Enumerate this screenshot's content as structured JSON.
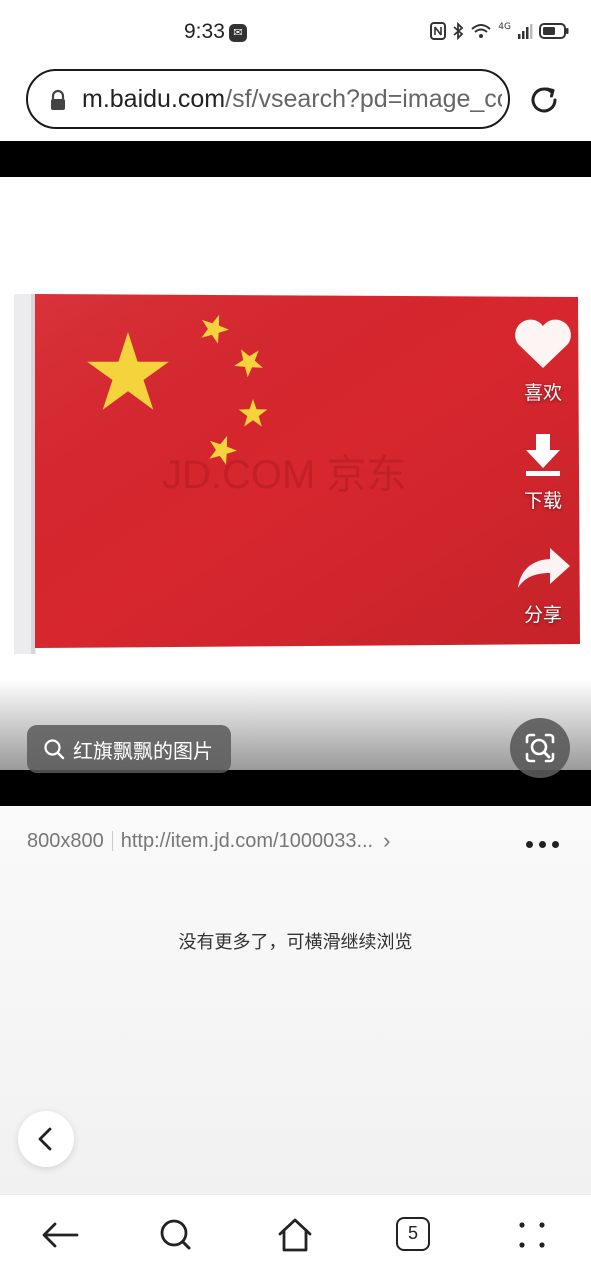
{
  "status_bar": {
    "time": "9:33",
    "network": "4G"
  },
  "browser": {
    "url_domain": "m.baidu.com",
    "url_path": "/sf/vsearch?pd=image_content&atn=mediacy"
  },
  "viewer": {
    "watermark": "JD.COM 京东",
    "actions": {
      "like": "喜欢",
      "download": "下载",
      "share": "分享"
    },
    "query_chip": "红旗飘飘的图片"
  },
  "image_info": {
    "dimensions": "800x800",
    "source": "http://item.jd.com/1000033...",
    "end_note": "没有更多了，可横滑继续浏览"
  },
  "bottom_nav": {
    "tab_count": "5"
  },
  "colors": {
    "flag_red": "#d7262e",
    "star_yellow": "#f5d33c"
  }
}
